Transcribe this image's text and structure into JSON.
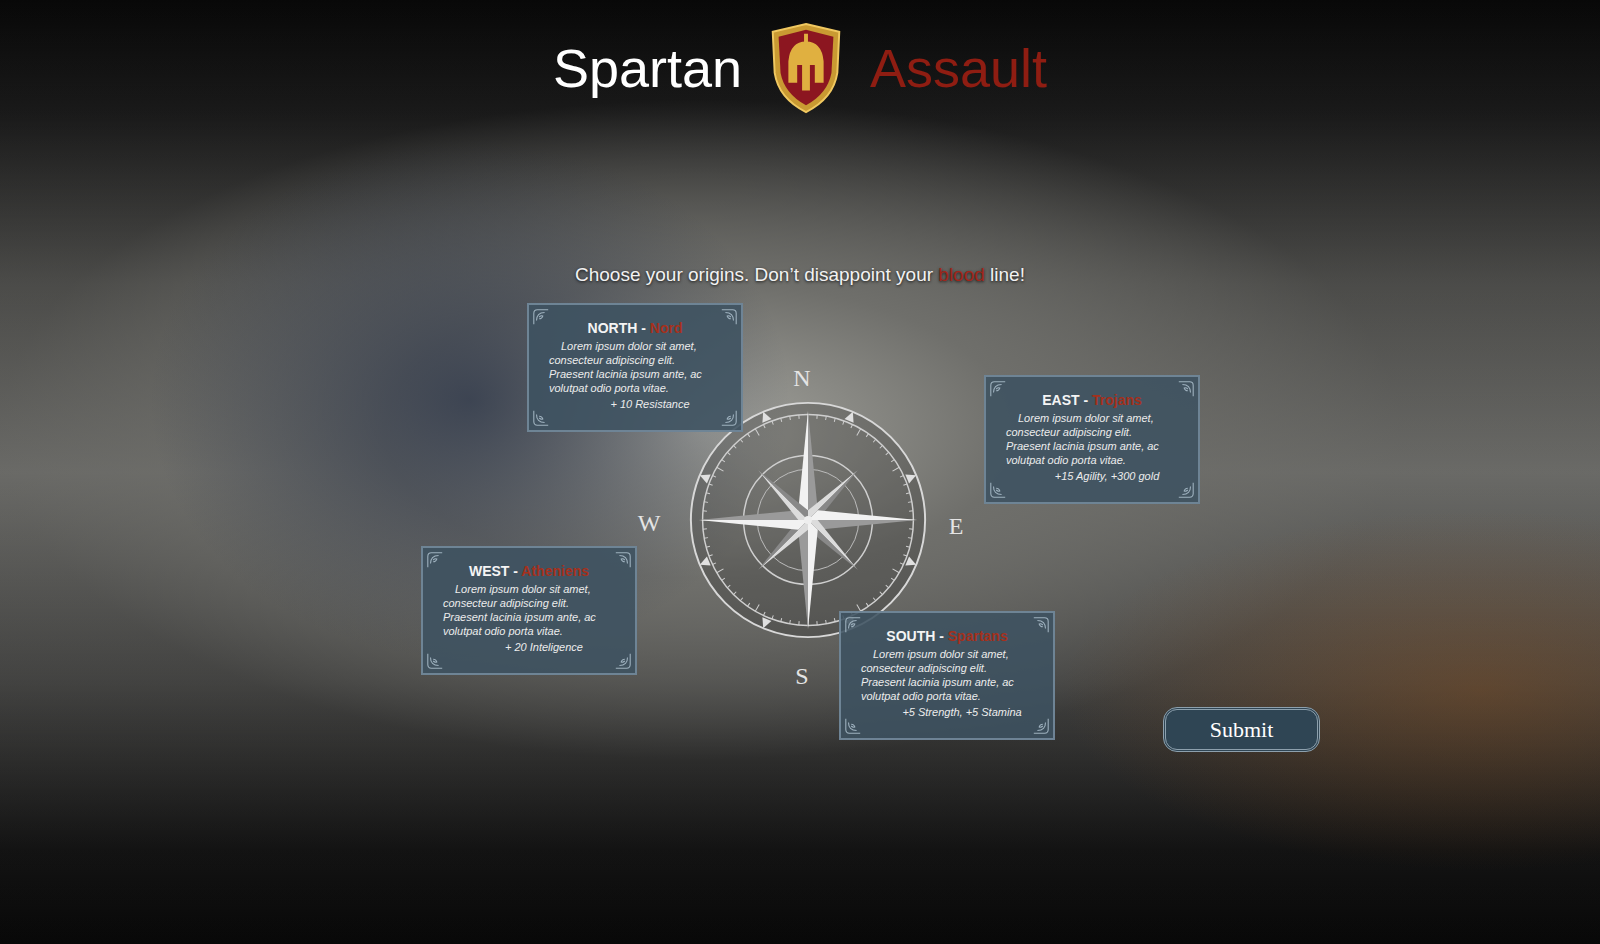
{
  "title": {
    "left": "Spartan",
    "right": "Assault"
  },
  "prompt": {
    "before": "Choose your origins. Don’t disappoint your ",
    "highlight": "blood",
    "after": " line!"
  },
  "compass": {
    "north": "N",
    "east": "E",
    "south": "S",
    "west": "W"
  },
  "origins": [
    {
      "direction": "NORTH - ",
      "faction": "Nord",
      "description": "Lorem ipsum dolor sit amet, consecteur adipiscing elit. Praesent lacinia ipsum ante, ac volutpat odio porta vitae.",
      "bonus": "+ 10 Resistance",
      "selected": false
    },
    {
      "direction": "EAST - ",
      "faction": "Trojans",
      "description": "Lorem ipsum dolor sit amet, consecteur adipiscing elit. Praesent lacinia ipsum ante, ac volutpat odio porta vitae.",
      "bonus": "+15 Agility, +300 gold",
      "selected": false
    },
    {
      "direction": "WEST - ",
      "faction": "Atheniens",
      "description": "Lorem ipsum dolor sit amet, consecteur adipiscing elit. Praesent lacinia ipsum ante, ac volutpat odio porta vitae.",
      "bonus": "+ 20 Inteligence",
      "selected": false
    },
    {
      "direction": "SOUTH - ",
      "faction": "Spartans",
      "description": "Lorem ipsum dolor sit amet, consecteur adipiscing elit. Praesent lacinia ipsum ante, ac volutpat odio porta vitae.",
      "bonus": "+5 Strength, +5 Stamina",
      "selected": false
    }
  ],
  "submit": "Submit"
}
